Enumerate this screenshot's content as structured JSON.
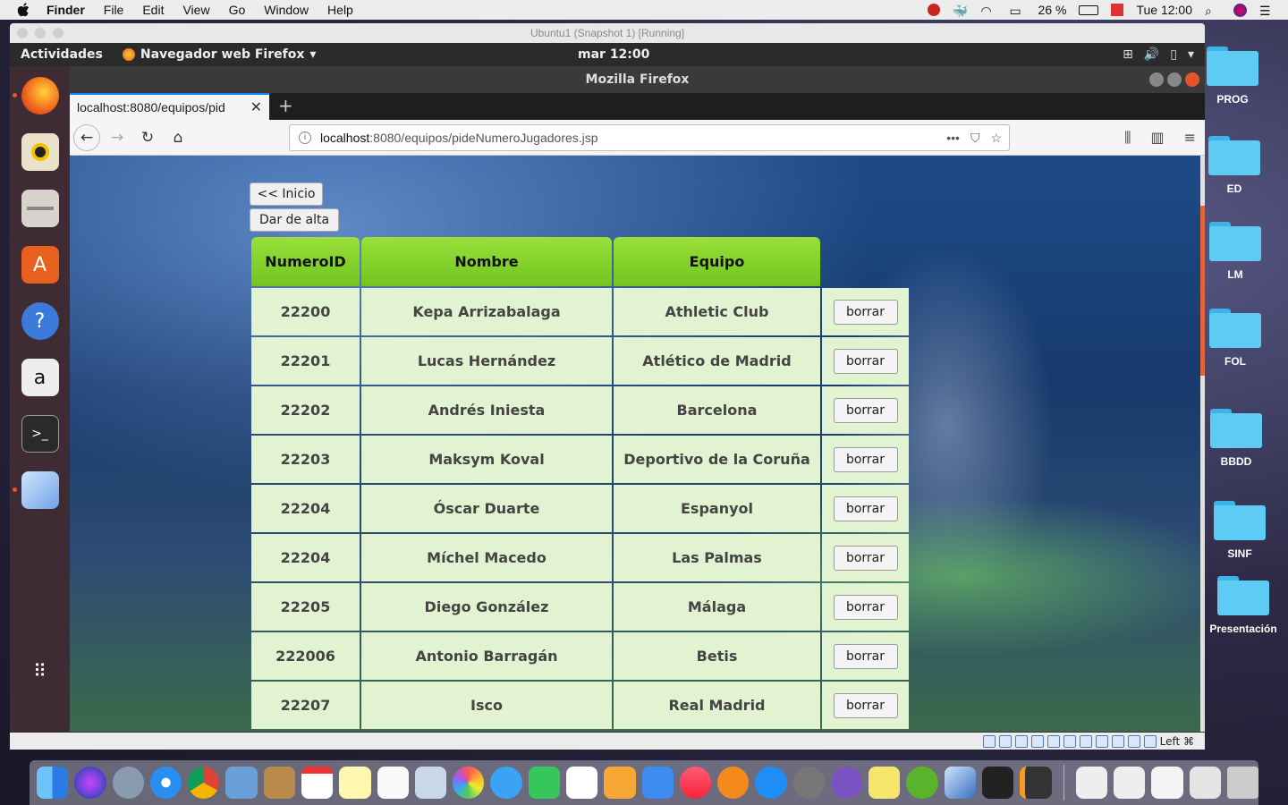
{
  "mac_menubar": {
    "app": "Finder",
    "menus": [
      "File",
      "Edit",
      "View",
      "Go",
      "Window",
      "Help"
    ],
    "battery": "26 %",
    "clock": "Tue 12:00"
  },
  "desktop_folders": [
    "PROG",
    "ED",
    "LM",
    "FOL",
    "BBDD",
    "SINF",
    "Presentación"
  ],
  "vm": {
    "title": "Ubuntu1 (Snapshot 1) [Running]",
    "status_key": "Left ⌘"
  },
  "ubuntu": {
    "activities": "Actividades",
    "app_menu": "Navegador web Firefox",
    "clock": "mar 12:00"
  },
  "firefox": {
    "window_title": "Mozilla Firefox",
    "tab_label": "localhost:8080/equipos/pid",
    "url_host": "localhost",
    "url_path": ":8080/equipos/pideNumeroJugadores.jsp"
  },
  "page": {
    "back_button": "<< Inicio",
    "add_button": "Dar de alta",
    "columns": [
      "NumeroID",
      "Nombre",
      "Equipo"
    ],
    "delete_label": "borrar",
    "rows": [
      {
        "id": "22200",
        "nombre": "Kepa Arrizabalaga",
        "equipo": "Athletic Club"
      },
      {
        "id": "22201",
        "nombre": "Lucas Hernández",
        "equipo": "Atlético de Madrid"
      },
      {
        "id": "22202",
        "nombre": "Andrés Iniesta",
        "equipo": "Barcelona"
      },
      {
        "id": "22203",
        "nombre": "Maksym Koval",
        "equipo": "Deportivo de la Coruña"
      },
      {
        "id": "22204",
        "nombre": "Óscar Duarte",
        "equipo": "Espanyol"
      },
      {
        "id": "22204",
        "nombre": "Míchel Macedo",
        "equipo": "Las Palmas"
      },
      {
        "id": "22205",
        "nombre": "Diego González",
        "equipo": "Málaga"
      },
      {
        "id": "222006",
        "nombre": "Antonio Barragán",
        "equipo": "Betis"
      },
      {
        "id": "22207",
        "nombre": "Isco",
        "equipo": "Real Madrid"
      }
    ]
  },
  "colors": {
    "header_green": "#7fcf27",
    "cell_green": "#e2f3d2",
    "firefox_accent": "#0a84ff",
    "ubuntu_launcher": "#3f2b33"
  }
}
